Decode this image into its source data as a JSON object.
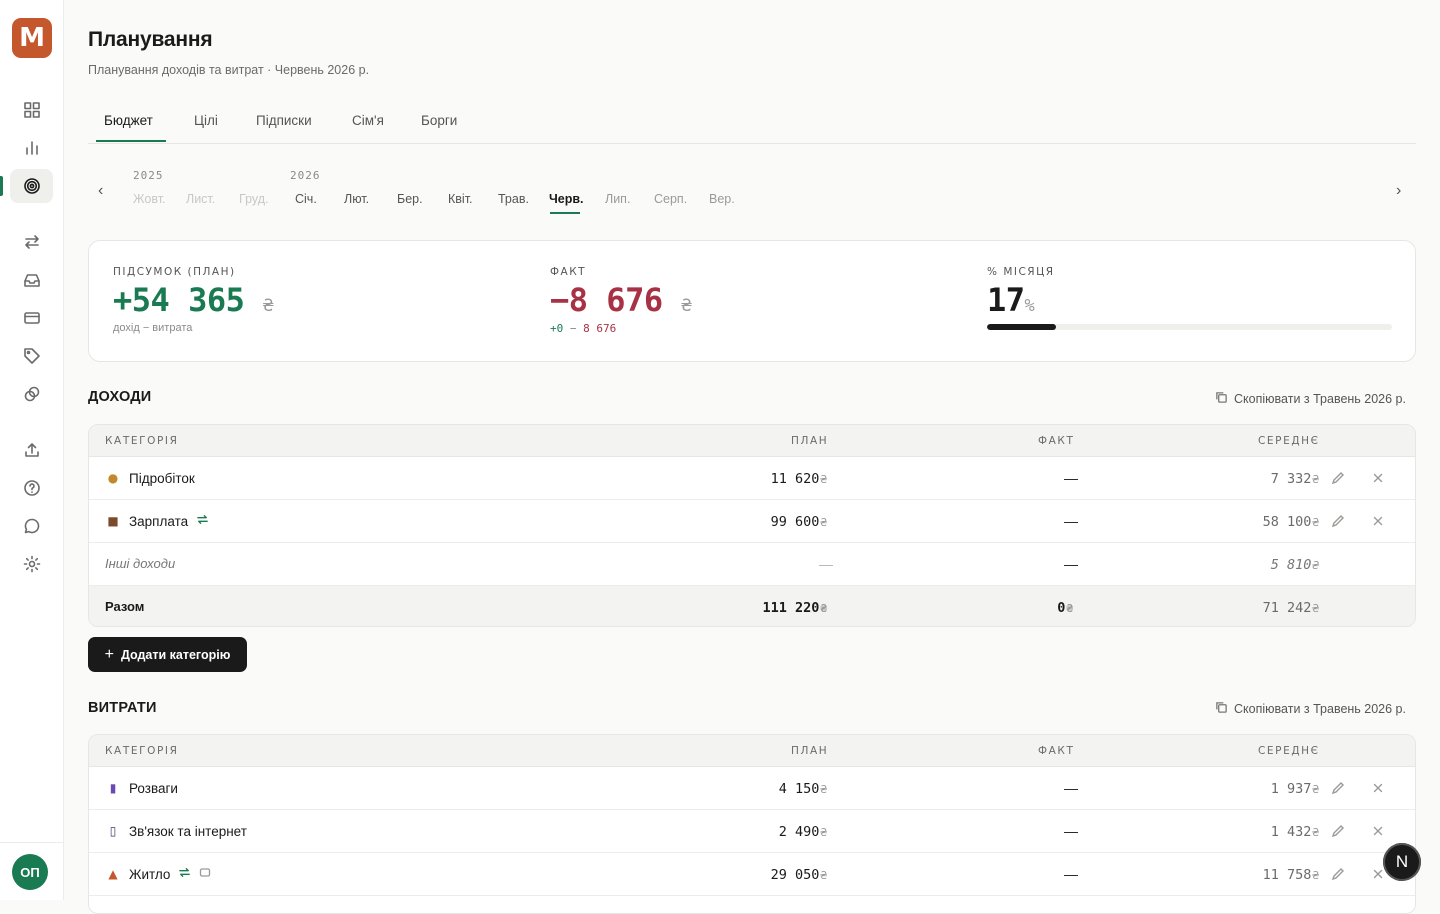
{
  "app": {
    "logo_letter": "M",
    "avatar_initials": "ОП",
    "fab_letter": "N"
  },
  "sidebar": {
    "icons": [
      "dashboard-icon",
      "chart-icon",
      "target-icon",
      "transfer-icon",
      "inbox-icon",
      "card-icon",
      "tag-icon",
      "coins-icon",
      "upload-icon",
      "help-icon",
      "chat-icon",
      "settings-icon"
    ]
  },
  "header": {
    "title": "Планування",
    "subtitle": "Планування доходів та витрат · Червень 2026 р."
  },
  "tabs": [
    "Бюджет",
    "Цілі",
    "Підписки",
    "Сім'я",
    "Борги"
  ],
  "months": {
    "year_left": "2025",
    "year_right": "2026",
    "items": [
      "Жовт.",
      "Лист.",
      "Груд.",
      "Січ.",
      "Лют.",
      "Бер.",
      "Квіт.",
      "Трав.",
      "Черв.",
      "Лип.",
      "Серп.",
      "Вер."
    ],
    "selected": "Черв."
  },
  "summary": {
    "plan_label": "ПІДСУМОК (ПЛАН)",
    "plan_value": "+54 365",
    "plan_currency": "₴",
    "plan_note": "дохід − витрата",
    "fact_label": "ФАКТ",
    "fact_value": "−8 676",
    "fact_currency": "₴",
    "fact_note_income": "+0",
    "fact_note_sep": " − ",
    "fact_note_expense": "8 676",
    "month_label": "% МІСЯЦЯ",
    "month_value": "17",
    "month_unit": "%",
    "month_progress": 0.17
  },
  "income": {
    "title": "ДОХОДИ",
    "copy_label": "Скопіювати з Травень 2026 р.",
    "headers": {
      "category": "КАТЕГОРІЯ",
      "plan": "ПЛАН",
      "fact": "ФАКТ",
      "avg": "СЕРЕДНЄ"
    },
    "rows": [
      {
        "emoji": "💰",
        "name": "Підробіток",
        "plan": "11 620",
        "fact": "—",
        "avg": "7 332"
      },
      {
        "emoji": "💼",
        "name": "Зарплата",
        "plan": "99 600",
        "fact": "—",
        "avg": "58 100"
      }
    ],
    "other": {
      "name": "Інші доходи",
      "plan": "—",
      "fact": "—",
      "avg": "5 810"
    },
    "total": {
      "name": "Разом",
      "plan": "111 220",
      "fact": "0",
      "avg": "71 242"
    },
    "currency": "₴"
  },
  "add_button": "Додати категорію",
  "expenses": {
    "title": "ВИТРАТИ",
    "copy_label": "Скопіювати з Травень 2026 р.",
    "headers": {
      "category": "КАТЕГОРІЯ",
      "plan": "ПЛАН",
      "fact": "ФАКТ",
      "avg": "СЕРЕДНЄ"
    },
    "rows": [
      {
        "emoji": "🎬",
        "name": "Розваги",
        "plan": "4 150",
        "fact": "—",
        "avg": "1 937"
      },
      {
        "emoji": "📱",
        "name": "Зв'язок та інтернет",
        "plan": "2 490",
        "fact": "—",
        "avg": "1 432"
      },
      {
        "emoji": "🏠",
        "name": "Житло",
        "plan": "29 050",
        "fact": "—",
        "avg": "11 758"
      }
    ],
    "currency": "₴"
  }
}
